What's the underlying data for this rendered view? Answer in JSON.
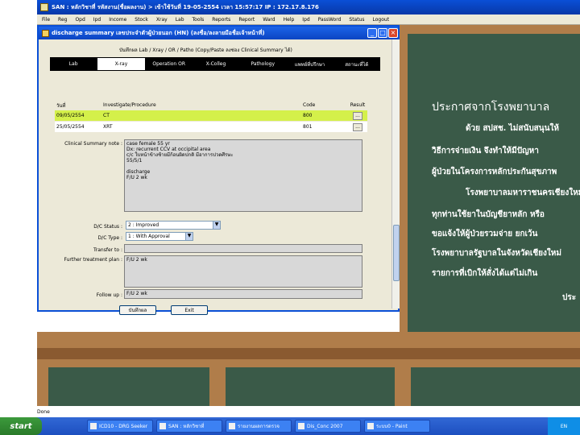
{
  "app": {
    "title": "SAN : หลักวิชาที่ รหัสงาน(ชื่อผลงาน) > เข้าใช้วันที่ 19-05-2554 เวลา 15:57:17 IP : 172.17.8.176",
    "menu": [
      "File",
      "Reg",
      "Opd",
      "Ipd",
      "Income",
      "Stock",
      "Xray",
      "Lab",
      "Tools",
      "Reports",
      "Report",
      "Ward",
      "Help",
      "Ipd",
      "PassWord",
      "Status",
      "Logout"
    ]
  },
  "dialog": {
    "title": "discharge summary  เลขประจำตัวผู้ป่วยนอก (HN) (ลงชื่อ/ลงลายมือชื่อเจ้าหน้าที่)",
    "header_note": "บันทึกผล Lab / Xray / OR / Patho (Copy/Paste ลงช่อง Clinical Summary ได้)",
    "tabs": [
      "Lab",
      "X-ray",
      "Operation OR",
      "X-Colleg",
      "Pathology",
      "แพทย์ที่ปรึกษา",
      "สถานะที่ได้"
    ],
    "active_tab": "X-ray",
    "xray_columns": {
      "date": "วันที่",
      "investigate": "Investigate/Procedure",
      "code": "Code",
      "result": "Result"
    },
    "xray_rows": [
      {
        "date": "09/05/2554",
        "investigate": "CT",
        "code": "800",
        "result_btn": "..."
      },
      {
        "date": "25/05/2554",
        "investigate": "XRT",
        "code": "801",
        "result_btn": "..."
      }
    ],
    "clinical_summary_label": "Clinical Summary note :",
    "clinical_summary_text": "case female 55 yr\nDx: recurrent CCV at occipital area\nc/c ใบหน้าข้างซ้ายมีก้อนผิดปกติ มีอาการปวดศีรษะ\n55/5/1\n\ndischarge\nF/U 2 wk",
    "dc_status_label": "D/C Status :",
    "dc_status_value": "2 : Improved",
    "dc_type_label": "D/C Type :",
    "dc_type_value": "1 : With Approval",
    "transfer_label": "Transfer to :",
    "transfer_value": "",
    "further_label": "Further treatment plan :",
    "further_value": "F/U 2 wk",
    "follow_label": "Follow up :",
    "follow_value": "F/U 2 wk",
    "save_label": "บันทึกผล",
    "exit_label": "Exit"
  },
  "chalkboard": {
    "lines": [
      "ประกาศจากโรงพยาบาล",
      "ด้วย สปสช. ไม่สนับสนุนให้",
      "วิธีการจ่ายเงิน จึงทำให้มีปัญหา",
      "ผู้ป่วยในโครงการหลักประกันสุขภาพ",
      "โรงพยาบาลมหาราชนครเชียงใหม่",
      "ทุกท่านใช้ยาในบัญชียาหลัก หรือ",
      "ขอแจ้งให้ผู้ป่วยรวมจ่าย ยกเว้น",
      "โรงพยาบาลรัฐบาลในจังหวัดเชียงใหม่",
      "รายการที่เบิกให้สั่งได้แต่ไม่เกิน",
      "ประ"
    ]
  },
  "status_bar": "Done",
  "taskbar": {
    "start_label": "start",
    "items": [
      "ICD10 - DRG Seeker",
      "SAN : หลักวิชาที่",
      "รายงานผลการตรวจ",
      "Dis_Conc 2007",
      "ระบบ0 - Paint"
    ],
    "tray": "EN"
  }
}
